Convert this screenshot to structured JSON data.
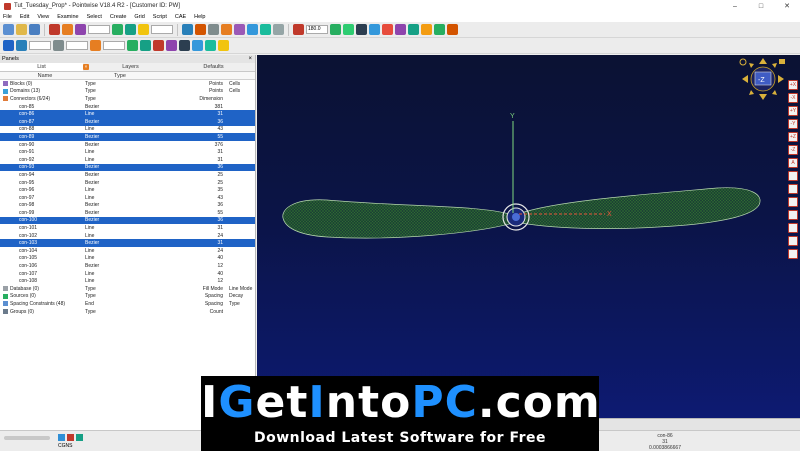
{
  "window": {
    "title": "Tut_Tuesday_Prop* - Pointwise V18.4 R2 - [Customer ID: PW]",
    "controls": [
      "–",
      "□",
      "✕"
    ]
  },
  "menu": [
    "File",
    "Edit",
    "View",
    "Examine",
    "Select",
    "Create",
    "Grid",
    "Script",
    "CAE",
    "Help"
  ],
  "toolbar": {
    "field1": "",
    "zoom_field": "180.0"
  },
  "panels": {
    "title": "Panels",
    "tabs": [
      "List",
      "Layers",
      "Defaults"
    ],
    "columns": [
      "Name",
      "Type"
    ],
    "groups_top": [
      {
        "name": "Blocks (0)",
        "type": "Type",
        "c3": "Points",
        "c4": "Cells"
      },
      {
        "name": "Domains (13)",
        "type": "Type",
        "c3": "Points",
        "c4": "Cells"
      },
      {
        "name": "Connectors (6/24)",
        "type": "Type",
        "c3": "Dimension",
        "c4": ""
      }
    ],
    "connectors": [
      {
        "name": "con-85",
        "type": "Bezier",
        "dim": "381",
        "selected": false
      },
      {
        "name": "con-86",
        "type": "Line",
        "dim": "31",
        "selected": true
      },
      {
        "name": "con-87",
        "type": "Bezier",
        "dim": "36",
        "selected": true
      },
      {
        "name": "con-88",
        "type": "Line",
        "dim": "43",
        "selected": false
      },
      {
        "name": "con-89",
        "type": "Bezier",
        "dim": "55",
        "selected": true
      },
      {
        "name": "con-90",
        "type": "Bezier",
        "dim": "376",
        "selected": false
      },
      {
        "name": "con-91",
        "type": "Line",
        "dim": "31",
        "selected": false
      },
      {
        "name": "con-92",
        "type": "Line",
        "dim": "31",
        "selected": false
      },
      {
        "name": "con-93",
        "type": "Bezier",
        "dim": "36",
        "selected": true
      },
      {
        "name": "con-94",
        "type": "Bezier",
        "dim": "25",
        "selected": false
      },
      {
        "name": "con-95",
        "type": "Bezier",
        "dim": "25",
        "selected": false
      },
      {
        "name": "con-96",
        "type": "Line",
        "dim": "35",
        "selected": false
      },
      {
        "name": "con-97",
        "type": "Line",
        "dim": "43",
        "selected": false
      },
      {
        "name": "con-98",
        "type": "Bezier",
        "dim": "36",
        "selected": false
      },
      {
        "name": "con-99",
        "type": "Bezier",
        "dim": "55",
        "selected": false
      },
      {
        "name": "con-100",
        "type": "Bezier",
        "dim": "36",
        "selected": true
      },
      {
        "name": "con-101",
        "type": "Line",
        "dim": "31",
        "selected": false
      },
      {
        "name": "con-102",
        "type": "Line",
        "dim": "24",
        "selected": false
      },
      {
        "name": "con-103",
        "type": "Bezier",
        "dim": "31",
        "selected": true
      },
      {
        "name": "con-104",
        "type": "Line",
        "dim": "24",
        "selected": false
      },
      {
        "name": "con-105",
        "type": "Line",
        "dim": "40",
        "selected": false
      },
      {
        "name": "con-106",
        "type": "Bezier",
        "dim": "12",
        "selected": false
      },
      {
        "name": "con-107",
        "type": "Line",
        "dim": "40",
        "selected": false
      },
      {
        "name": "con-108",
        "type": "Line",
        "dim": "12",
        "selected": false
      }
    ],
    "groups_bottom": [
      {
        "name": "Database (0)",
        "type": "Type",
        "c3": "Fill Mode",
        "c4": "Line Mode"
      },
      {
        "name": "Sources (0)",
        "type": "Type",
        "c3": "Spacing",
        "c4": "Decay"
      },
      {
        "name": "Spacing Constraints (48)",
        "type": "End",
        "c3": "Spacing",
        "c4": "Type"
      },
      {
        "name": "Groups (0)",
        "type": "Type",
        "c3": "Count",
        "c4": ""
      }
    ]
  },
  "viewport": {
    "background_top": "#0b1233",
    "background_bottom": "#0d1a72",
    "mesh_color": "#5fc24a",
    "axis_y_color": "#7fd87f",
    "axis_x_color": "#e8553a"
  },
  "view_cube": {
    "label": "-Z"
  },
  "right_tools": [
    "+X",
    "-X",
    "+Y",
    "-Y",
    "+Z",
    "-Z",
    "A",
    "",
    "",
    "",
    "",
    "",
    "",
    ""
  ],
  "statusbar": {
    "solver": "CGNS",
    "selection_name": "con-86",
    "selection_dim": "31",
    "selection_value": "0.0003866667"
  },
  "watermark": {
    "brand_white1": "I",
    "brand_blue1": "G",
    "brand_white2": "et",
    "brand_blue2": "I",
    "brand_white3": "nto",
    "brand_blue3": "PC",
    "brand_white4": ".com",
    "tagline": "Download Latest Software for Free"
  }
}
